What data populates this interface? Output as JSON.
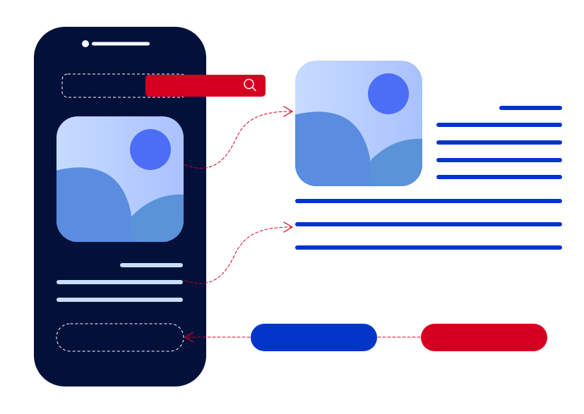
{
  "illustration": {
    "icons": {
      "search": "search-icon",
      "image_placeholder": "image-placeholder-icon"
    },
    "colors": {
      "phone_body": "#02103A",
      "accent_red": "#D50020",
      "primary_blue": "#0035C8",
      "light_line": "#C9DEFF",
      "image_sky_light": "#C5D9FF",
      "image_sky_dark": "#A8C0FF",
      "image_hill": "#5A8CDF",
      "image_sun": "#4C6DF5",
      "connector": "#D50020",
      "dashed_placeholder": "#FFFFFF"
    }
  }
}
